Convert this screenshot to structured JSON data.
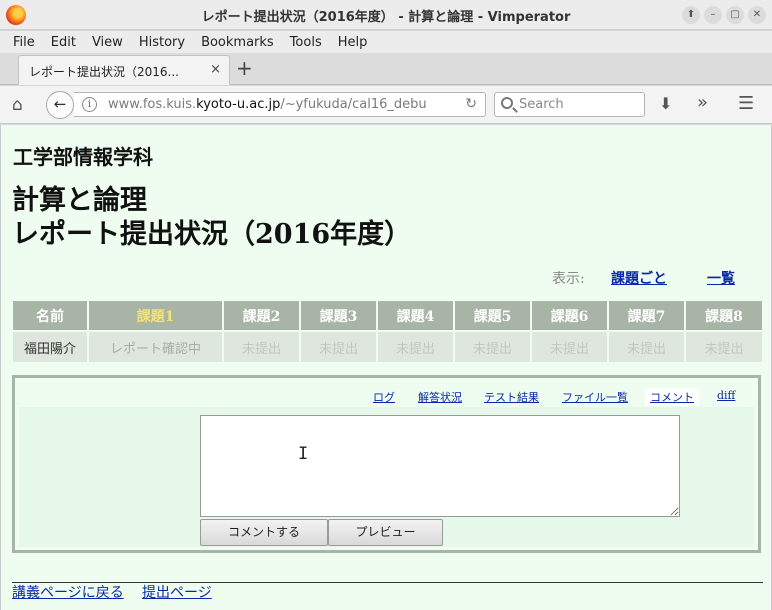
{
  "window": {
    "title": "レポート提出状況（2016年度） - 計算と論理 - Vimperator",
    "controls": [
      "up-arrow",
      "minimize",
      "maximize",
      "close"
    ]
  },
  "menubar": [
    "File",
    "Edit",
    "View",
    "History",
    "Bookmarks",
    "Tools",
    "Help"
  ],
  "tab": {
    "title": "レポート提出状況（2016...",
    "close": "×",
    "new_tab": "+"
  },
  "navbar": {
    "url_prefix": "www.fos.kuis.",
    "url_host": "kyoto-u.ac.jp",
    "url_suffix": "/~yfukuda/cal16_debu",
    "search_placeholder": "Search"
  },
  "page": {
    "department": "工学部情報学科",
    "heading_line1": "計算と論理",
    "heading_line2": "レポート提出状況（2016年度）",
    "view_label": "表示:",
    "view_by_task": "課題ごと",
    "view_list": "一覧"
  },
  "status_table": {
    "headers": [
      "名前",
      "課題1",
      "課題2",
      "課題3",
      "課題4",
      "課題5",
      "課題6",
      "課題7",
      "課題8"
    ],
    "row": [
      "福田陽介",
      "レポート確認中",
      "未提出",
      "未提出",
      "未提出",
      "未提出",
      "未提出",
      "未提出",
      "未提出"
    ],
    "current_index": 1
  },
  "panel": {
    "tabs": [
      "ログ",
      "解答状況",
      "テスト結果",
      "ファイル一覧",
      "コメント",
      "diff"
    ],
    "active_tab": "コメント",
    "comment_value": "",
    "submit_label": "コメントする",
    "preview_label": "プレビュー"
  },
  "footer": {
    "back_link": "講義ページに戻る",
    "submit_link": "提出ページ"
  }
}
